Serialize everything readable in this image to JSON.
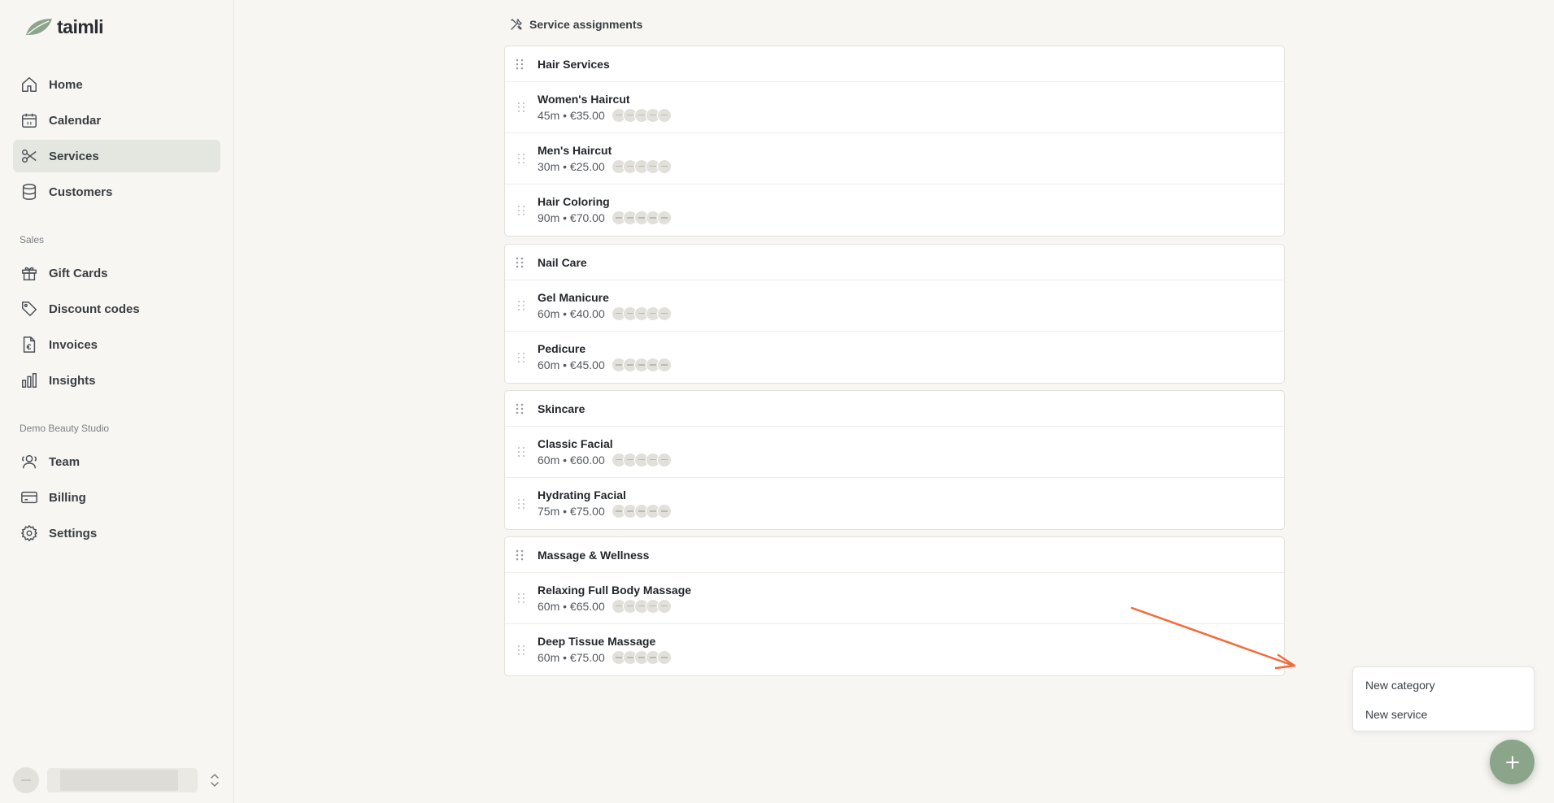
{
  "brand": {
    "name": "taimli",
    "accent": "#8aa58a",
    "annotation_color": "#f26b3a"
  },
  "sidebar": {
    "main_items": [
      {
        "label": "Home",
        "icon": "home-icon",
        "active": false
      },
      {
        "label": "Calendar",
        "icon": "calendar-icon",
        "active": false
      },
      {
        "label": "Services",
        "icon": "scissors-icon",
        "active": true
      },
      {
        "label": "Customers",
        "icon": "database-icon",
        "active": false
      }
    ],
    "sales_label": "Sales",
    "sales_items": [
      {
        "label": "Gift Cards",
        "icon": "gift-icon"
      },
      {
        "label": "Discount codes",
        "icon": "tag-icon"
      },
      {
        "label": "Invoices",
        "icon": "invoice-euro-icon"
      },
      {
        "label": "Insights",
        "icon": "bar-chart-icon"
      }
    ],
    "org_label": "Demo Beauty Studio",
    "org_items": [
      {
        "label": "Team",
        "icon": "users-icon"
      },
      {
        "label": "Billing",
        "icon": "credit-card-icon"
      },
      {
        "label": "Settings",
        "icon": "gear-icon"
      }
    ]
  },
  "main": {
    "section_title": "Service assignments",
    "categories": [
      {
        "name": "Hair Services",
        "services": [
          {
            "name": "Women's Haircut",
            "detail": "45m • €35.00"
          },
          {
            "name": "Men's Haircut",
            "detail": "30m • €25.00"
          },
          {
            "name": "Hair Coloring",
            "detail": "90m • €70.00"
          }
        ]
      },
      {
        "name": "Nail Care",
        "services": [
          {
            "name": "Gel Manicure",
            "detail": "60m • €40.00"
          },
          {
            "name": "Pedicure",
            "detail": "60m • €45.00"
          }
        ]
      },
      {
        "name": "Skincare",
        "services": [
          {
            "name": "Classic Facial",
            "detail": "60m • €60.00"
          },
          {
            "name": "Hydrating Facial",
            "detail": "75m • €75.00"
          }
        ]
      },
      {
        "name": "Massage & Wellness",
        "services": [
          {
            "name": "Relaxing Full Body Massage",
            "detail": "60m • €65.00"
          },
          {
            "name": "Deep Tissue Massage",
            "detail": "60m • €75.00"
          }
        ]
      }
    ]
  },
  "menu": {
    "new_category": "New category",
    "new_service": "New service"
  }
}
